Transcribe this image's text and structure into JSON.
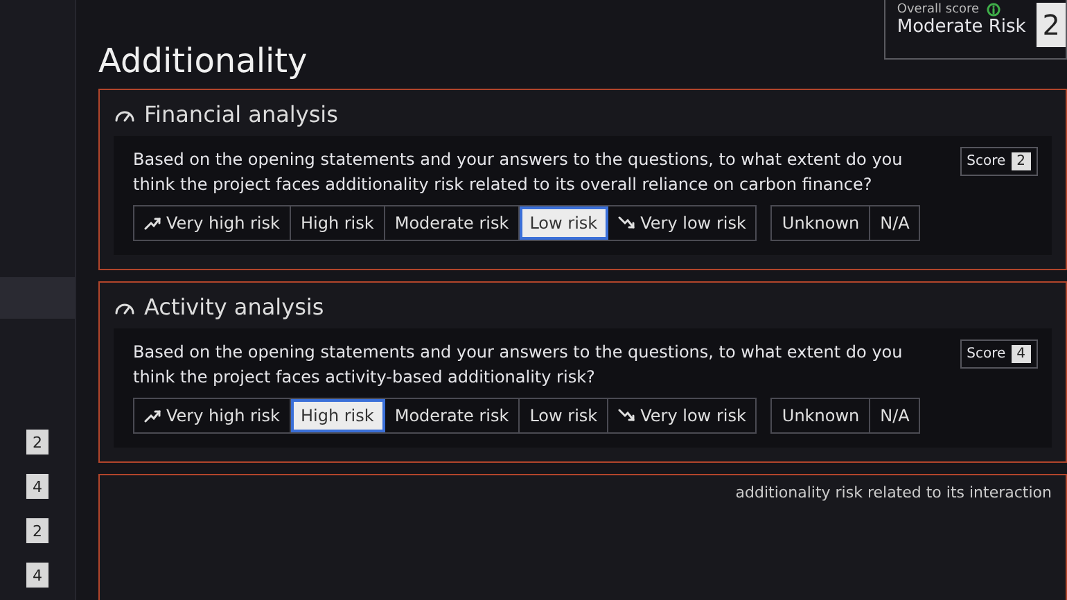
{
  "page_title": "Additionality",
  "overall_score": {
    "label": "Overall score",
    "value": "Moderate Risk",
    "score": "2"
  },
  "sidebar": {
    "scores": [
      "2",
      "4",
      "2",
      "4"
    ]
  },
  "sections": [
    {
      "title": "Financial analysis",
      "question": "Based on the opening statements and your answers to the questions, to what extent do you think the project faces additionality risk related to its overall reliance on carbon finance?",
      "score_label": "Score",
      "score": "2",
      "risk_options": [
        {
          "label": "Very high risk",
          "kind": "up",
          "selected": false
        },
        {
          "label": "High risk",
          "kind": "plain",
          "selected": false
        },
        {
          "label": "Moderate risk",
          "kind": "plain",
          "selected": false
        },
        {
          "label": "Low risk",
          "kind": "plain",
          "selected": true
        },
        {
          "label": "Very low risk",
          "kind": "down",
          "selected": false
        }
      ],
      "other_options": [
        {
          "label": "Unknown",
          "selected": false
        },
        {
          "label": "N/A",
          "selected": false
        }
      ]
    },
    {
      "title": "Activity analysis",
      "question": "Based on the opening statements and your answers to the questions, to what extent do you think the project faces activity-based additionality risk?",
      "score_label": "Score",
      "score": "4",
      "risk_options": [
        {
          "label": "Very high risk",
          "kind": "up",
          "selected": false
        },
        {
          "label": "High risk",
          "kind": "plain",
          "selected": true
        },
        {
          "label": "Moderate risk",
          "kind": "plain",
          "selected": false
        },
        {
          "label": "Low risk",
          "kind": "plain",
          "selected": false
        },
        {
          "label": "Very low risk",
          "kind": "down",
          "selected": false
        }
      ],
      "other_options": [
        {
          "label": "Unknown",
          "selected": false
        },
        {
          "label": "N/A",
          "selected": false
        }
      ]
    }
  ],
  "next_question_fragment": "additionality risk related to its interaction"
}
